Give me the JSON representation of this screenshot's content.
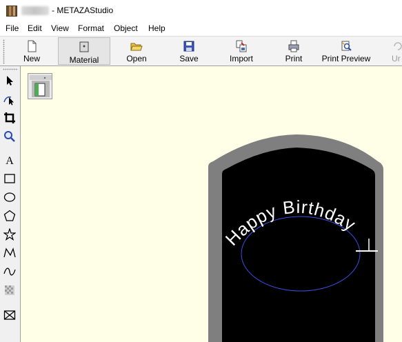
{
  "window": {
    "title": "- METAZAStudio"
  },
  "menubar": {
    "items": [
      "File",
      "Edit",
      "View",
      "Format",
      "Object",
      "Help"
    ]
  },
  "toolbar": {
    "buttons": [
      {
        "label": "New",
        "icon": "new-document-icon"
      },
      {
        "label": "Material",
        "icon": "material-icon",
        "pressed": true
      },
      {
        "label": "Open",
        "icon": "open-folder-icon"
      },
      {
        "label": "Save",
        "icon": "floppy-disk-icon"
      },
      {
        "label": "Import",
        "icon": "import-icon"
      },
      {
        "label": "Print",
        "icon": "printer-icon"
      },
      {
        "label": "Print Preview",
        "icon": "print-preview-icon"
      },
      {
        "label": "Ur",
        "icon": "undo-icon",
        "disabled": true
      }
    ]
  },
  "palette": {
    "tools": [
      "select-arrow-icon",
      "node-edit-icon",
      "crop-icon",
      "zoom-icon",
      "text-icon",
      "rectangle-icon",
      "ellipse-icon",
      "polygon-icon",
      "star-icon",
      "polyline-icon",
      "curve-icon",
      "image-trace-icon",
      "clear-icon"
    ]
  },
  "canvas": {
    "text_on_path": "Happy Birthday",
    "colors": {
      "background": "#ffffe8",
      "material_border": "#7f7f7f",
      "material_fill": "#000000",
      "text": "#ffffff",
      "path": "#3b4fe0"
    }
  }
}
